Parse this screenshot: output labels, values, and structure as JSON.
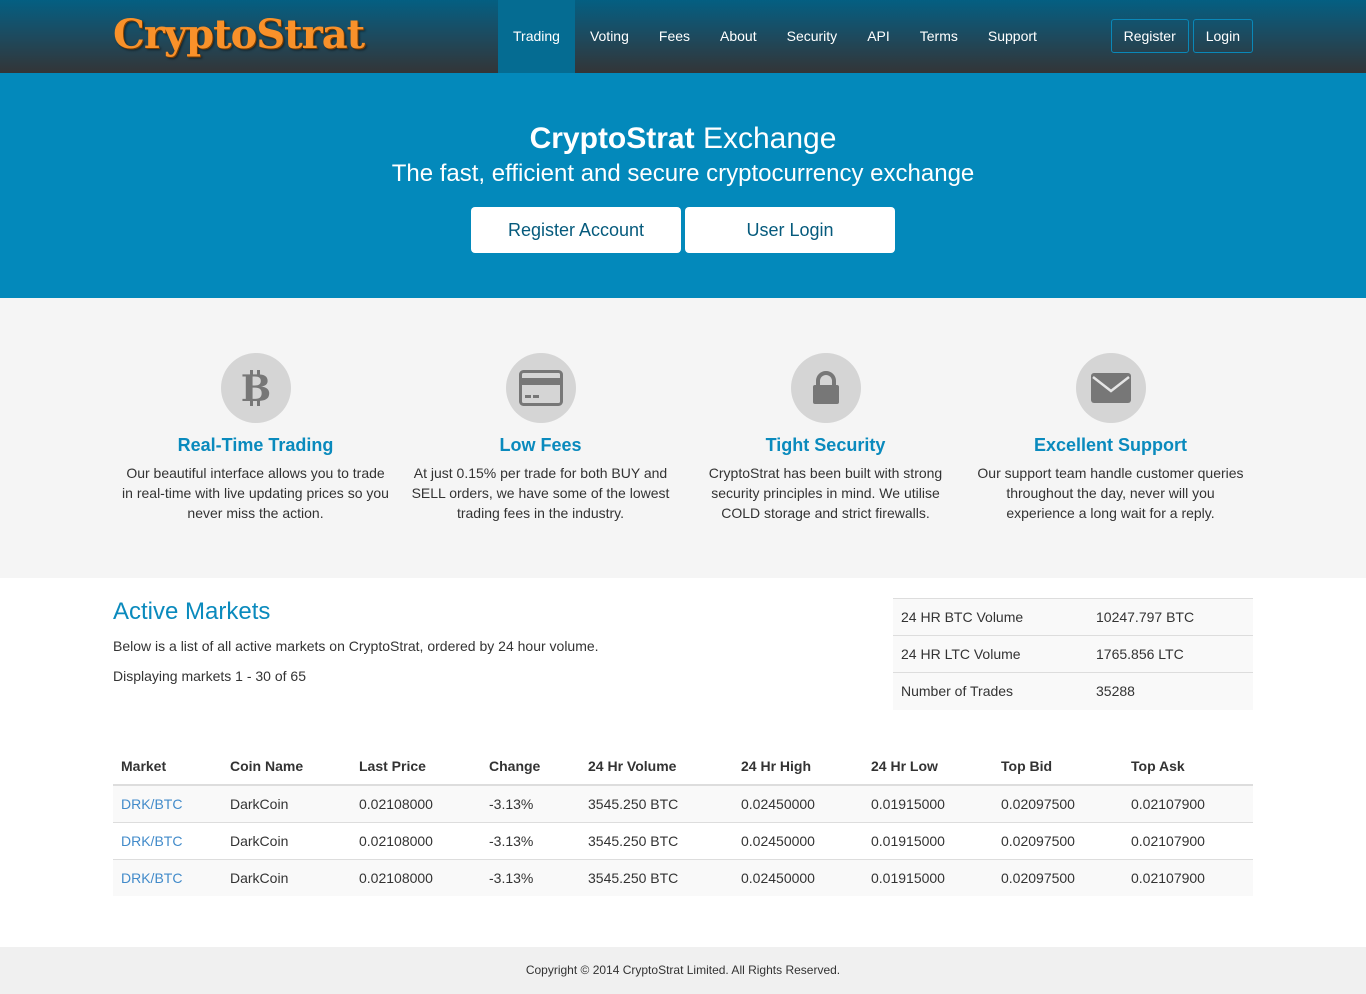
{
  "brand": {
    "logo_text": "CryptoStrat"
  },
  "nav": {
    "items": [
      {
        "label": "Trading",
        "active": true
      },
      {
        "label": "Voting",
        "active": false
      },
      {
        "label": "Fees",
        "active": false
      },
      {
        "label": "About",
        "active": false
      },
      {
        "label": "Security",
        "active": false
      },
      {
        "label": "API",
        "active": false
      },
      {
        "label": "Terms",
        "active": false
      },
      {
        "label": "Support",
        "active": false
      }
    ],
    "register_label": "Register",
    "login_label": "Login"
  },
  "hero": {
    "title_bold": "CryptoStrat",
    "title_rest": " Exchange",
    "tagline": "The fast, efficient and secure cryptocurrency exchange",
    "register_button": "Register Account",
    "login_button": "User Login"
  },
  "features": [
    {
      "icon": "bitcoin-icon",
      "title": "Real-Time Trading",
      "text": "Our beautiful interface allows you to trade in real-time with live updating prices so you never miss the action."
    },
    {
      "icon": "credit-card-icon",
      "title": "Low Fees",
      "text": "At just 0.15% per trade for both BUY and SELL orders, we have some of the lowest trading fees in the industry."
    },
    {
      "icon": "lock-icon",
      "title": "Tight Security",
      "text": "CryptoStrat has been built with strong security principles in mind. We utilise COLD storage and strict firewalls."
    },
    {
      "icon": "envelope-icon",
      "title": "Excellent Support",
      "text": "Our support team handle customer queries throughout the day, never will you experience a long wait for a reply."
    }
  ],
  "markets": {
    "title": "Active Markets",
    "description": "Below is a list of all active markets on CryptoStrat, ordered by 24 hour volume.",
    "count_text": "Displaying markets 1 - 30 of 65",
    "stats": [
      {
        "label": "24 HR BTC Volume",
        "value": "10247.797 BTC"
      },
      {
        "label": "24 HR LTC Volume",
        "value": "1765.856 LTC"
      },
      {
        "label": "Number of Trades",
        "value": "35288"
      }
    ],
    "columns": [
      "Market",
      "Coin Name",
      "Last Price",
      "Change",
      "24 Hr Volume",
      "24 Hr High",
      "24 Hr Low",
      "Top Bid",
      "Top Ask"
    ],
    "rows": [
      [
        "DRK/BTC",
        "DarkCoin",
        "0.02108000",
        "-3.13%",
        "3545.250 BTC",
        "0.02450000",
        "0.01915000",
        "0.02097500",
        "0.02107900"
      ],
      [
        "DRK/BTC",
        "DarkCoin",
        "0.02108000",
        "-3.13%",
        "3545.250 BTC",
        "0.02450000",
        "0.01915000",
        "0.02097500",
        "0.02107900"
      ],
      [
        "DRK/BTC",
        "DarkCoin",
        "0.02108000",
        "-3.13%",
        "3545.250 BTC",
        "0.02450000",
        "0.01915000",
        "0.02097500",
        "0.02107900"
      ]
    ]
  },
  "footer": {
    "copyright": "Copyright © 2014 CryptoStrat Limited. All Rights Reserved."
  },
  "colors": {
    "accent": "#0389bb",
    "heading": "#0a8abd",
    "logo": "#f9912a",
    "link": "#428bca"
  }
}
